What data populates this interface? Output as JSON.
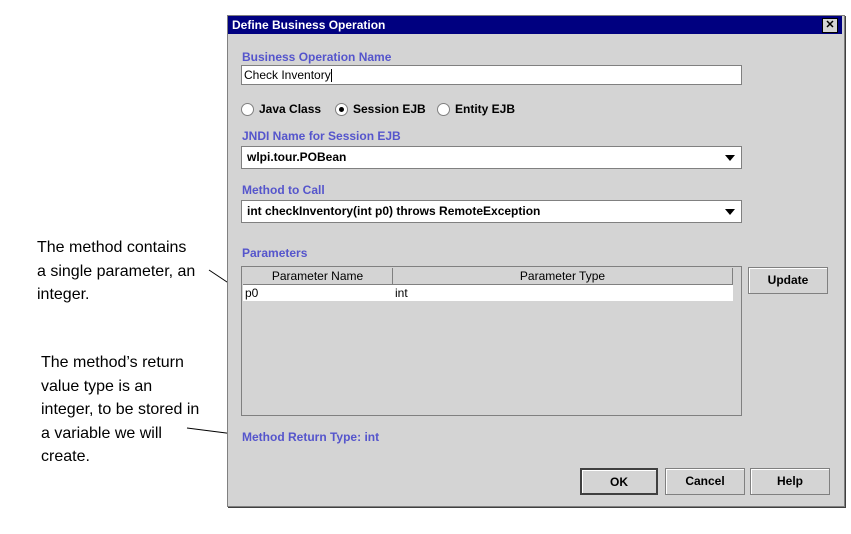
{
  "annotations": [
    "The method contains a single parameter, an integer.",
    "The method’s return value type is an integer, to be stored in a variable we will create."
  ],
  "annotation_lines": {
    "a1": [
      "The method contains",
      "a single parameter, an",
      "integer."
    ],
    "a2": [
      "The method’s return",
      "value type is an",
      "integer, to be stored in",
      "a variable we will",
      "create."
    ]
  },
  "dialog": {
    "title": "Define Business Operation",
    "close": "✕",
    "name_label": "Business Operation Name",
    "name_value": "Check Inventory",
    "radios": [
      {
        "label": "Java Class",
        "selected": false
      },
      {
        "label": "Session EJB",
        "selected": true
      },
      {
        "label": "Entity EJB",
        "selected": false
      }
    ],
    "jndi_label": "JNDI Name for Session EJB",
    "jndi_value": "wlpi.tour.POBean",
    "method_label": "Method to Call",
    "method_value": "int checkInventory(int p0) throws RemoteException",
    "params_label": "Parameters",
    "table": {
      "headers": [
        "Parameter Name",
        "Parameter Type"
      ],
      "rows": [
        [
          "p0",
          "int"
        ]
      ]
    },
    "update": "Update",
    "return_type": "Method Return Type: int",
    "ok": "OK",
    "cancel": "Cancel",
    "help": "Help"
  }
}
